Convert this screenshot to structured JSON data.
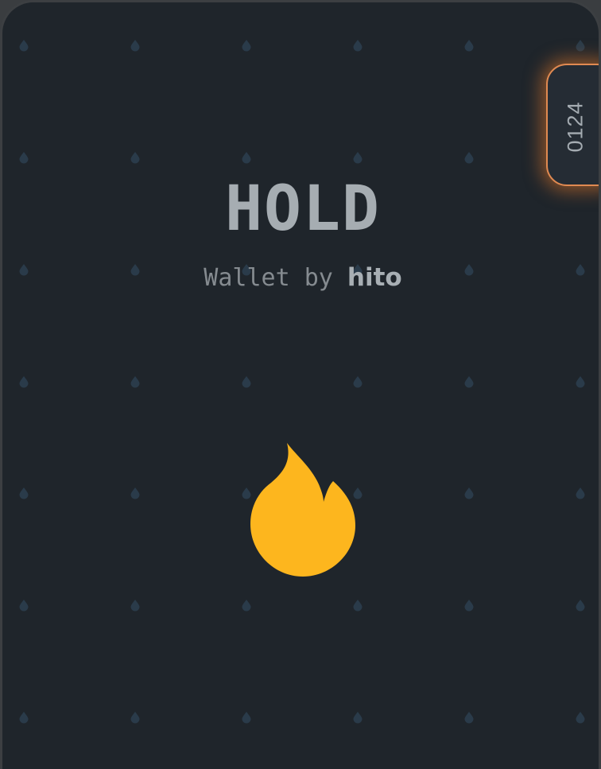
{
  "card": {
    "title": "HOLD",
    "subtitle_prefix": "Wallet by ",
    "brand": "hito",
    "serial_number": "0124"
  },
  "colors": {
    "background": "#1f252b",
    "pattern_drop": "#2a3b4a",
    "title": "#a6adb2",
    "flame": "#fdb61e",
    "tab_glow": "#e08a52"
  },
  "icons": {
    "center": "fire-icon",
    "pattern": "droplet-icon"
  }
}
